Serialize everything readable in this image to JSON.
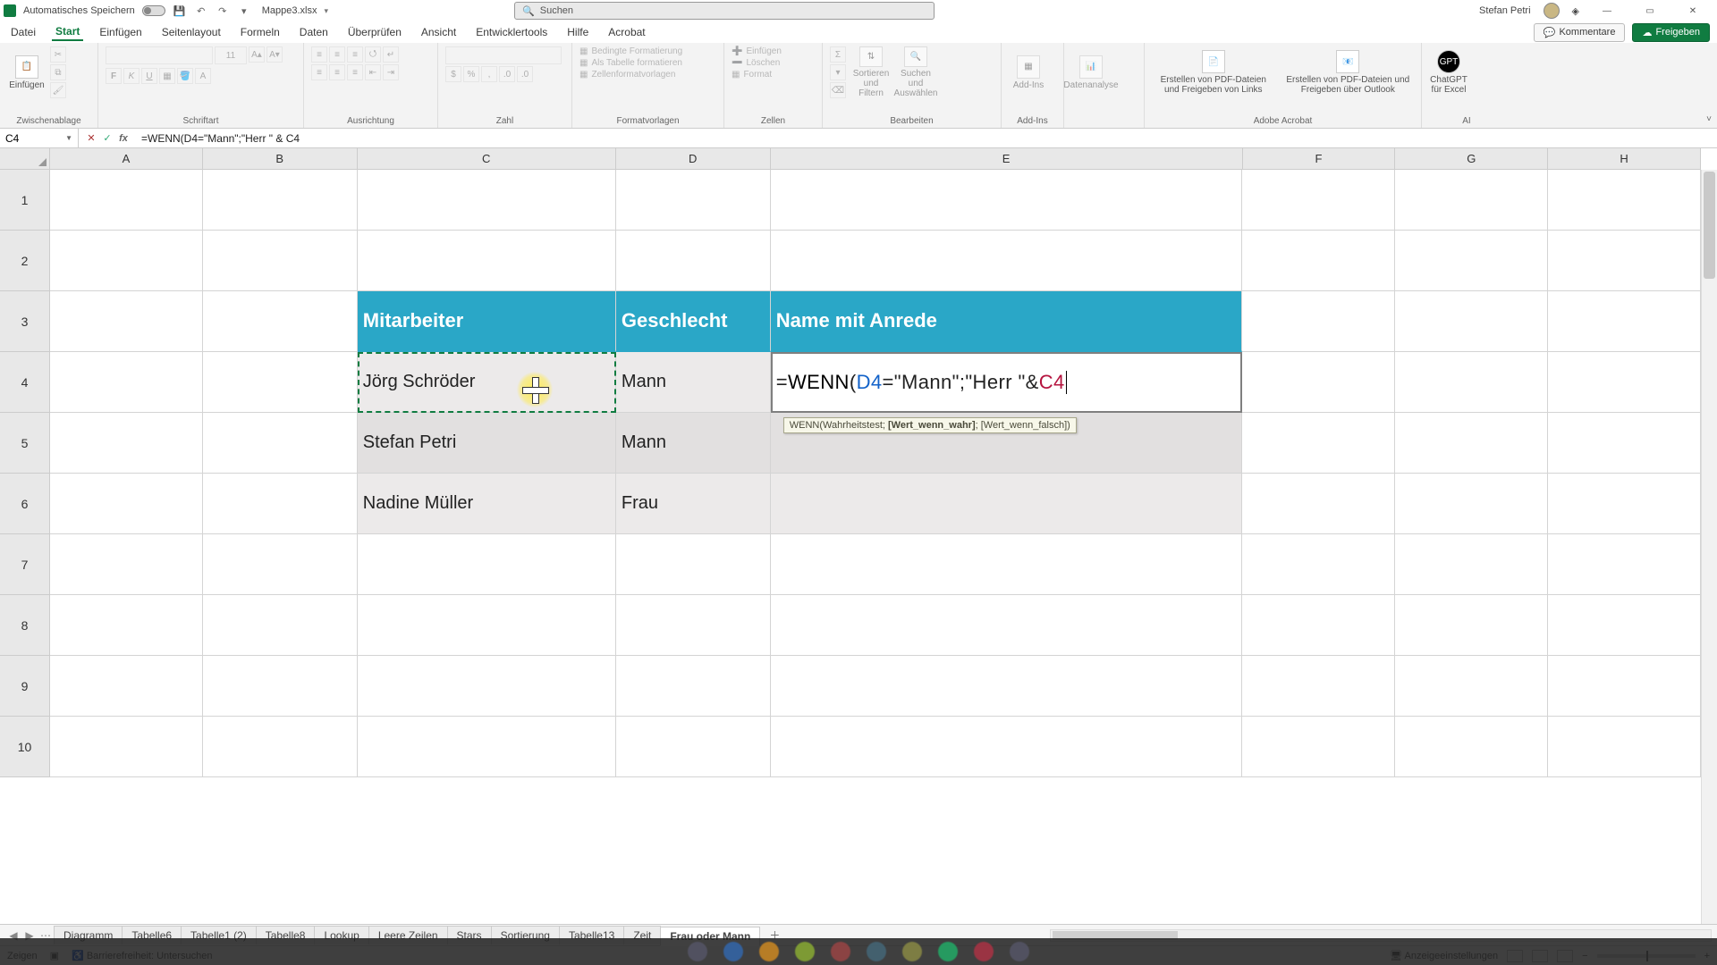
{
  "titlebar": {
    "autosave_label": "Automatisches Speichern",
    "doc_name": "Mappe3.xlsx",
    "search_placeholder": "Suchen",
    "user_name": "Stefan Petri"
  },
  "menu": {
    "tabs": [
      "Datei",
      "Start",
      "Einfügen",
      "Seitenlayout",
      "Formeln",
      "Daten",
      "Überprüfen",
      "Ansicht",
      "Entwicklertools",
      "Hilfe",
      "Acrobat"
    ],
    "active_index": 1,
    "comments": "Kommentare",
    "share": "Freigeben"
  },
  "ribbon": {
    "groups": {
      "clipboard": {
        "label": "Zwischenablage",
        "paste": "Einfügen"
      },
      "font": {
        "label": "Schriftart",
        "size": "11"
      },
      "align": {
        "label": "Ausrichtung"
      },
      "number": {
        "label": "Zahl"
      },
      "styles": {
        "label": "Formatvorlagen",
        "cond": "Bedingte Formatierung",
        "astable": "Als Tabelle formatieren",
        "cellstyles": "Zellenformatvorlagen"
      },
      "cells": {
        "label": "Zellen",
        "insert": "Einfügen",
        "delete": "Löschen",
        "format": "Format"
      },
      "editing": {
        "label": "Bearbeiten",
        "sortfilter": "Sortieren und Filtern",
        "findselect": "Suchen und Auswählen"
      },
      "addins": {
        "label": "Add-Ins",
        "addins_btn": "Add-Ins"
      },
      "analyze": {
        "label": "",
        "analyze_btn": "Datenanalyse"
      },
      "acrobat": {
        "label": "Adobe Acrobat",
        "createshare": "Erstellen von PDF-Dateien und Freigeben von Links",
        "createoutlook": "Erstellen von PDF-Dateien und Freigeben über Outlook"
      },
      "ai": {
        "label": "AI",
        "gpt": "ChatGPT für Excel"
      }
    }
  },
  "formula_bar": {
    "namebox": "C4",
    "formula": "=WENN(D4=\"Mann\";\"Herr \" & C4"
  },
  "grid": {
    "columns": [
      "A",
      "B",
      "C",
      "D",
      "E",
      "F",
      "G",
      "H"
    ],
    "rows": [
      "1",
      "2",
      "3",
      "4",
      "5",
      "6",
      "7",
      "8",
      "9",
      "10"
    ],
    "headers": {
      "c3": "Mitarbeiter",
      "d3": "Geschlecht",
      "e3": "Name mit Anrede"
    },
    "data": {
      "c4": "Jörg Schröder",
      "d4": "Mann",
      "c5": "Stefan Petri",
      "d5": "Mann",
      "c6": "Nadine Müller",
      "d6": "Frau"
    },
    "formula_parts": {
      "eq": "=",
      "fn": "WENN",
      "open": "(",
      "d4": "D4",
      "eqop": "=",
      "str1": "\"Mann\"",
      "semi": ";",
      "str2": "\"Herr \"",
      "amp": " & ",
      "c4": "C4"
    },
    "tooltip": {
      "fn": "WENN",
      "open": "(",
      "arg1": "Wahrheitstest;",
      "arg2": "[Wert_wenn_wahr]",
      "sep": "; ",
      "arg3": "[Wert_wenn_falsch]",
      "close": ")"
    }
  },
  "sheets": {
    "tabs": [
      "Diagramm",
      "Tabelle6",
      "Tabelle1 (2)",
      "Tabelle8",
      "Lookup",
      "Leere Zeilen",
      "Stars",
      "Sortierung",
      "Tabelle13",
      "Zeit",
      "Frau oder Mann"
    ],
    "active_index": 10
  },
  "status": {
    "mode": "Zeigen",
    "accessibility": "Barrierefreiheit: Untersuchen",
    "display_settings": "Anzeigeeinstellungen",
    "zoom": "100"
  }
}
